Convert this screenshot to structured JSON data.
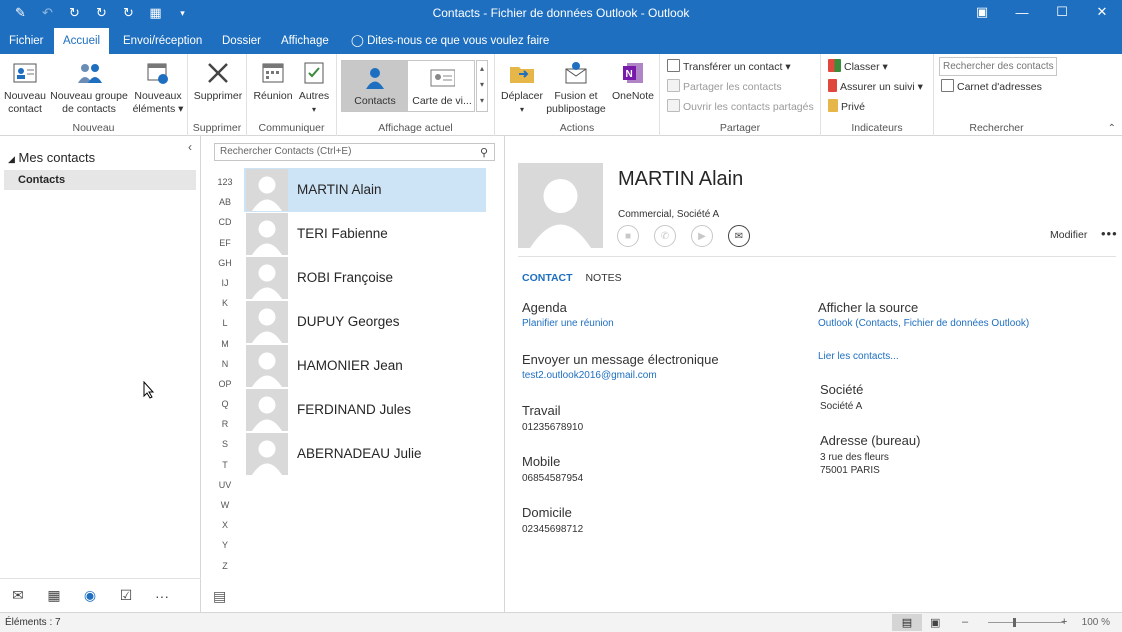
{
  "window": {
    "title": "Contacts - Fichier de données Outlook - Outlook",
    "qat_icons": [
      "compose-icon",
      "undo-icon",
      "send-receive-icon",
      "send-receive-all-icon",
      "send-receive-folder-icon",
      "calendar-grid-icon",
      "customize-qat-icon"
    ],
    "controls": [
      "restore-ribbon-icon",
      "minimize-icon",
      "maximize-icon",
      "close-icon"
    ]
  },
  "tabs": [
    {
      "label": "Fichier"
    },
    {
      "label": "Accueil",
      "active": true
    },
    {
      "label": "Envoi/réception"
    },
    {
      "label": "Dossier"
    },
    {
      "label": "Affichage"
    },
    {
      "label": "Dites-nous ce que vous voulez faire"
    }
  ],
  "ribbon": {
    "nouveau": {
      "label": "Nouveau",
      "nouveau_contact": "Nouveau contact",
      "nouveau_groupe": "Nouveau groupe de contacts",
      "nouveaux_elements": "Nouveaux éléments"
    },
    "supprimer": {
      "label": "Supprimer",
      "btn": "Supprimer"
    },
    "communiquer": {
      "label": "Communiquer",
      "reunion": "Réunion",
      "autres": "Autres"
    },
    "affichage": {
      "label": "Affichage actuel",
      "contacts": "Contacts",
      "carte": "Carte de vi..."
    },
    "actions": {
      "label": "Actions",
      "deplacer": "Déplacer",
      "fusion": "Fusion et publipostage",
      "onenote": "OneNote"
    },
    "partager": {
      "label": "Partager",
      "transferer": "Transférer un contact",
      "partager": "Partager les contacts",
      "ouvrir": "Ouvrir les contacts partagés"
    },
    "indicateurs": {
      "label": "Indicateurs",
      "classer": "Classer",
      "suivi": "Assurer un suivi",
      "prive": "Privé"
    },
    "rechercher": {
      "label": "Rechercher",
      "placeholder": "Rechercher des contacts",
      "carnet": "Carnet d'adresses"
    }
  },
  "nav": {
    "header": "Mes contacts",
    "item": "Contacts",
    "bottom_icons": [
      "mail-icon",
      "calendar-icon",
      "people-icon",
      "tasks-icon",
      "more-icon"
    ]
  },
  "list": {
    "search_placeholder": "Rechercher Contacts (Ctrl+E)",
    "alpha": [
      "123",
      "AB",
      "CD",
      "EF",
      "GH",
      "IJ",
      "K",
      "L",
      "M",
      "N",
      "OP",
      "Q",
      "R",
      "S",
      "T",
      "UV",
      "W",
      "X",
      "Y",
      "Z"
    ],
    "contacts": [
      {
        "name": "MARTIN Alain",
        "selected": true
      },
      {
        "name": "TERI Fabienne"
      },
      {
        "name": "ROBI Françoise"
      },
      {
        "name": "DUPUY Georges"
      },
      {
        "name": "HAMONIER Jean"
      },
      {
        "name": "FERDINAND Jules"
      },
      {
        "name": "ABERNADEAU Julie"
      }
    ]
  },
  "card": {
    "name": "MARTIN Alain",
    "subtitle": "Commercial, Société A",
    "modify": "Modifier",
    "more": "•••",
    "tab_contact": "CONTACT",
    "tab_notes": "NOTES",
    "agenda_label": "Agenda",
    "agenda_link": "Planifier une réunion",
    "email_label": "Envoyer un message électronique",
    "email_value": "test2.outlook2016@gmail.com",
    "travail_label": "Travail",
    "travail_value": "01235678910",
    "mobile_label": "Mobile",
    "mobile_value": "06854587954",
    "domicile_label": "Domicile",
    "domicile_value": "02345698712",
    "source_label": "Afficher la source",
    "source_link": "Outlook (Contacts, Fichier de données Outlook)",
    "lier_link": "Lier les contacts...",
    "societe_label": "Société",
    "societe_value": "Société A",
    "adresse_label": "Adresse (bureau)",
    "adresse_line1": "3 rue des fleurs",
    "adresse_line2": "75001 PARIS"
  },
  "status": {
    "count": "Éléments : 7",
    "zoom": "100 %",
    "zoom_level_percent": 100
  },
  "colors": {
    "accent": "#1e6fc0",
    "selected_row": "#cde3f6"
  }
}
